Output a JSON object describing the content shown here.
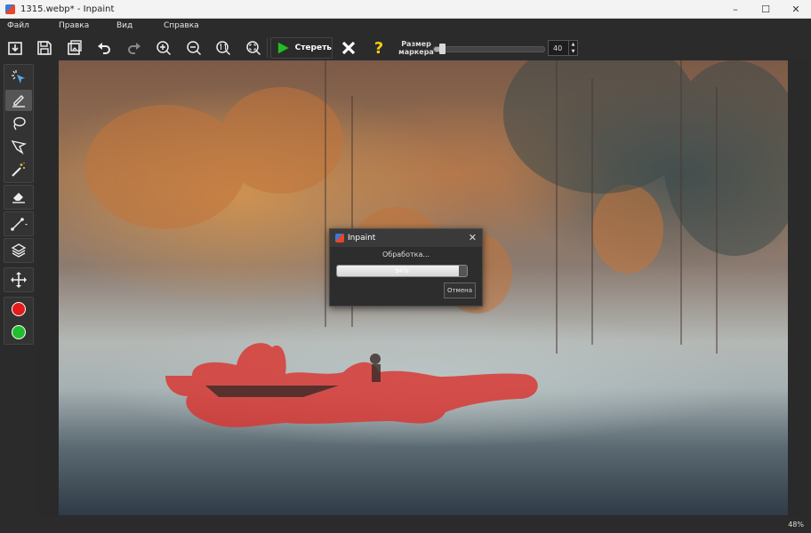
{
  "window": {
    "title": "1315.webp* - Inpaint",
    "controls": [
      "–",
      "☐",
      "✕"
    ]
  },
  "menu": {
    "items": [
      "Файл",
      "Правка",
      "Вид",
      "Справка"
    ]
  },
  "toolbar": {
    "erase_label": "Стереть",
    "marker_label_1": "Размер",
    "marker_label_2": "маркера",
    "marker_size": "40",
    "marker_level_fraction": 0.07,
    "buttons": [
      "open-icon",
      "save-icon",
      "save-as-icon",
      "undo-icon",
      "redo-icon",
      "zoom-in-icon",
      "zoom-out-icon",
      "actual-size-icon",
      "fit-icon",
      "erase-icon",
      "cancel-icon",
      "help-icon"
    ]
  },
  "tools": [
    "select-icon",
    "marker-icon",
    "lasso-icon",
    "polygon-lasso-icon",
    "magic-wand-icon",
    "eraser-icon",
    "line-icon",
    "layers-icon",
    "move-icon",
    "red-color-icon",
    "green-color-icon"
  ],
  "dialog": {
    "title": "Inpaint",
    "message": "Обработка...",
    "progress_text": "94%",
    "progress_fraction": 0.94,
    "cancel_label": "Отмена"
  },
  "status": {
    "zoom": "48%"
  },
  "colors": {
    "mask": "#d9352f",
    "accent_green": "#22bb22",
    "help_yellow": "#f2cc1a"
  }
}
